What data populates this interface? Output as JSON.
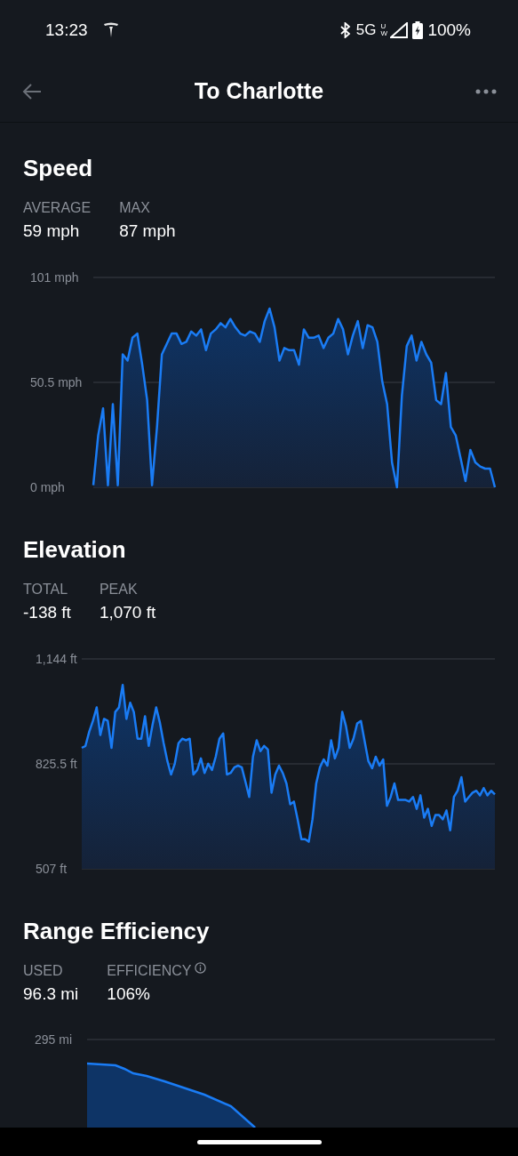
{
  "status_bar": {
    "time": "13:23",
    "network": "5G",
    "network_sub": "UW",
    "battery": "100%"
  },
  "header": {
    "title": "To Charlotte"
  },
  "sections": [
    {
      "title": "Speed",
      "stats": [
        {
          "label": "AVERAGE",
          "value": "59 mph",
          "info": false
        },
        {
          "label": "MAX",
          "value": "87 mph",
          "info": false
        }
      ],
      "chart_data": {
        "type": "area",
        "ylim": [
          0,
          101
        ],
        "yticks": [
          {
            "value": 0,
            "label": "0 mph"
          },
          {
            "value": 50.5,
            "label": "50.5 mph"
          },
          {
            "value": 101,
            "label": "101 mph"
          }
        ],
        "series": [
          {
            "color": "#1a7cf5",
            "values": [
              1,
              25,
              38,
              1,
              40,
              1,
              64,
              61,
              72,
              74,
              59,
              42,
              1,
              29,
              64,
              69,
              74,
              74,
              69,
              70,
              75,
              73,
              76,
              66,
              74,
              76,
              79,
              77,
              81,
              77,
              74,
              73,
              75,
              74,
              70,
              80,
              86,
              77,
              61,
              67,
              66,
              66,
              59,
              76,
              72,
              72,
              73,
              67,
              72,
              74,
              81,
              76,
              64,
              73,
              80,
              67,
              78,
              77,
              70,
              51,
              40,
              12,
              0,
              44,
              68,
              73,
              61,
              70,
              64,
              60,
              42,
              40,
              55,
              29,
              25,
              14,
              3,
              18,
              12,
              10,
              9,
              9,
              0
            ]
          }
        ]
      }
    },
    {
      "title": "Elevation",
      "stats": [
        {
          "label": "TOTAL",
          "value": "-138 ft",
          "info": false
        },
        {
          "label": "PEAK",
          "value": "1,070 ft",
          "info": false
        }
      ],
      "chart_data": {
        "type": "area",
        "ylim": [
          507,
          1144
        ],
        "yticks": [
          {
            "value": 507,
            "label": "507 ft"
          },
          {
            "value": 825.5,
            "label": "825.5 ft"
          },
          {
            "value": 1144,
            "label": "1,144 ft"
          }
        ],
        "series": [
          {
            "color": "#1a7cf5",
            "values": [
              874,
              880,
              923,
              956,
              997,
              913,
              962,
              956,
              874,
              983,
              997,
              1065,
              962,
              1011,
              983,
              902,
              902,
              970,
              880,
              943,
              997,
              950,
              888,
              834,
              793,
              826,
              888,
              902,
              897,
              902,
              793,
              807,
              842,
              798,
              826,
              807,
              847,
              902,
              918,
              793,
              798,
              815,
              820,
              815,
              771,
              725,
              847,
              897,
              864,
              880,
              869,
              738,
              793,
              820,
              798,
              766,
              703,
              711,
              657,
              597,
              597,
              589,
              657,
              766,
              815,
              839,
              820,
              897,
              842,
              874,
              983,
              940,
              874,
              902,
              948,
              956,
              894,
              834,
              812,
              847,
              820,
              839,
              698,
              725,
              766,
              716,
              716,
              716,
              711,
              725,
              689,
              730,
              662,
              689,
              637,
              670,
              670,
              657,
              684,
              624,
              725,
              744,
              785,
              711,
              725,
              738,
              744,
              730,
              752,
              730,
              744,
              733
            ]
          }
        ]
      }
    },
    {
      "title": "Range Efficiency",
      "stats": [
        {
          "label": "USED",
          "value": "96.3 mi",
          "info": false
        },
        {
          "label": "EFFICIENCY",
          "value": "106%",
          "info": true
        }
      ],
      "range_chart": {
        "tick_label": "295 mi"
      }
    }
  ]
}
